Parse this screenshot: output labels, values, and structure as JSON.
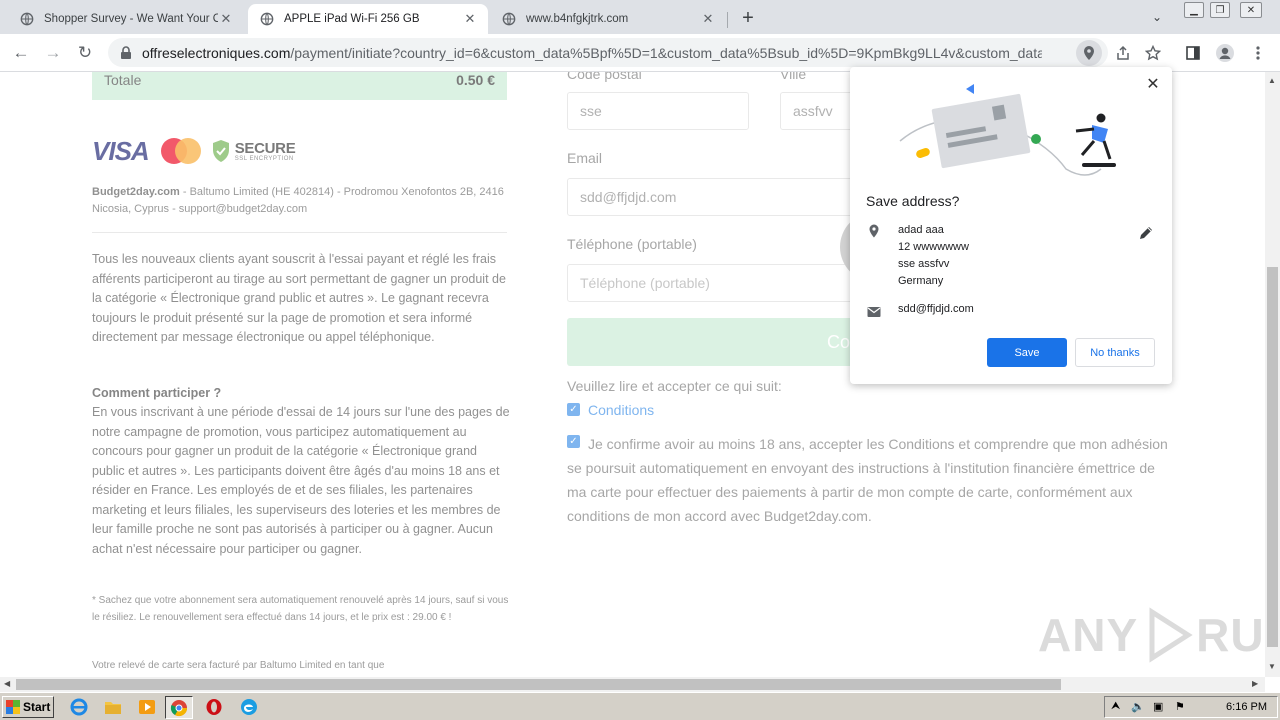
{
  "browser": {
    "tabs": [
      {
        "title": "Shopper Survey - We Want Your Op",
        "active": false
      },
      {
        "title": "APPLE iPad Wi-Fi 256 GB",
        "active": true
      },
      {
        "title": "www.b4nfgkjtrk.com",
        "active": false
      }
    ],
    "url_host": "offreselectroniques.com",
    "url_path": "/payment/initiate?country_id=6&custom_data%5Bpf%5D=1&custom_data%5Bsub_id%5D=9KpmBkg9LL4v&custom_data..."
  },
  "summary": {
    "total_label": "Totale",
    "total_value": "0.50 €"
  },
  "logos": {
    "visa": "VISA",
    "secure": "SECURE",
    "secure_sub": "SSL ENCRYPTION"
  },
  "company": {
    "name": "Budget2day.com",
    "details": " - Baltumo Limited (HE 402814) - Prodromou Xenofontos 2B, 2416 Nicosia, Cyprus - support@budget2day.com"
  },
  "legal": {
    "p1": "Tous les nouveaux clients ayant souscrit à l'essai payant et réglé les frais afférents participeront au tirage au sort permettant de gagner un produit de la catégorie « Électronique grand public et autres ». Le gagnant recevra toujours le produit présenté sur la page de promotion et sera informé directement par message électronique ou appel téléphonique.",
    "h2": "Comment participer ?",
    "p2": "En vous inscrivant à une période d'essai de 14 jours sur l'une des pages de notre campagne de promotion, vous participez automatiquement au concours pour gagner un produit de la catégorie « Électronique grand public et autres ». Les participants doivent être âgés d'au moins 18 ans et résider en France. Les employés de et de ses filiales, les partenaires marketing et leurs filiales, les superviseurs des loteries et les membres de leur famille proche ne sont pas autorisés à participer ou à gagner. Aucun achat n'est nécessaire pour participer ou gagner.",
    "fine1": "* Sachez que votre abonnement sera automatiquement renouvelé après 14 jours, sauf si vous le résiliez. Le renouvellement sera effectué dans 14 jours, et le prix est : 29.00 € !",
    "fine2": "Votre relevé de carte sera facturé par Baltumo Limited en tant que"
  },
  "form": {
    "postal_label": "Code postal",
    "postal_value": "sse",
    "city_label": "Ville",
    "city_value": "assfvv",
    "email_label": "Email",
    "email_value": "sdd@ffjdjd.com",
    "phone_label": "Téléphone (portable)",
    "phone_placeholder": "Téléphone (portable)",
    "submit_partial": "Co",
    "read_label": "Veuillez lire et accepter ce qui suit:",
    "conditions_link": "Conditions",
    "confirm_text": "Je confirme avoir au moins 18 ans, accepter les Conditions et comprendre que mon adhésion se poursuit automatiquement en envoyant des instructions à l'institution financière émettrice de ma carte pour effectuer des paiements à partir de mon compte de carte, conformément aux conditions de mon accord avec Budget2day.com."
  },
  "popup": {
    "title": "Save address?",
    "address_lines": [
      "adad aaa",
      "12 wwwwwww",
      "sse assfvv",
      "Germany"
    ],
    "email": "sdd@ffjdjd.com",
    "save": "Save",
    "no_thanks": "No thanks"
  },
  "watermark": {
    "left": "ANY",
    "right": "RUN"
  },
  "taskbar": {
    "start": "Start",
    "clock": "6:16 PM"
  },
  "colors": {
    "accent_blue": "#1a73e8",
    "success_green": "#c8ebd4",
    "link_blue": "#3b8ee6"
  }
}
